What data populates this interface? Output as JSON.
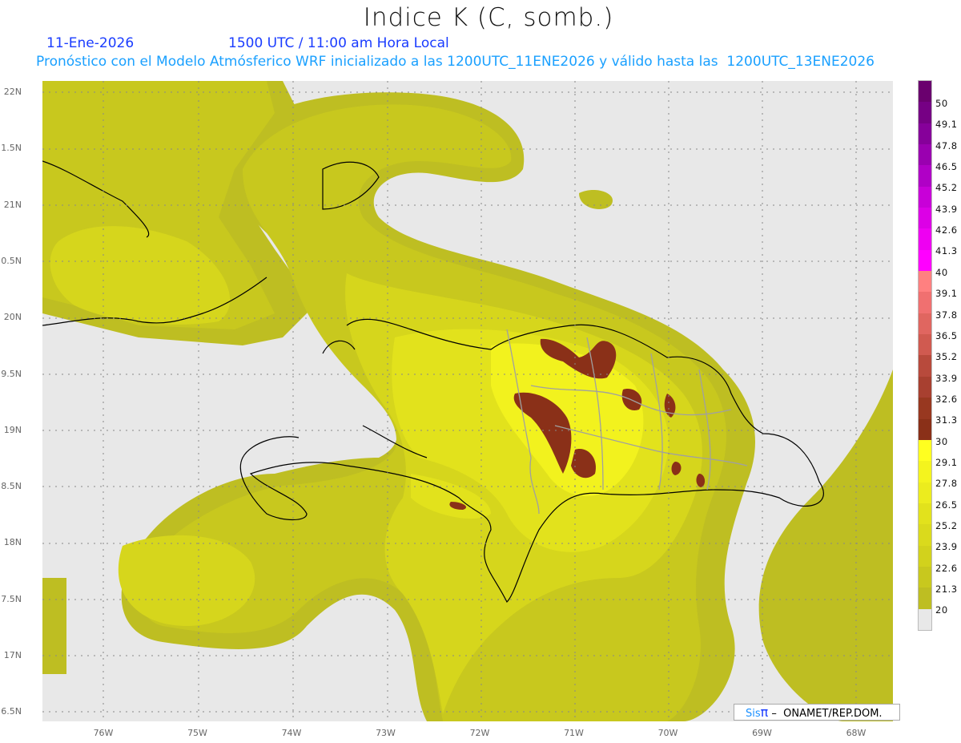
{
  "header": {
    "title": "Indice K (C, somb.)",
    "date": "11-Ene-2026",
    "time": "1500 UTC / 11:00 am Hora Local",
    "description": "Pronóstico con el Modelo Atmósferico WRF inicializado a las 1200UTC_11ENE2026 y válido hasta las  1200UTC_13ENE2026"
  },
  "map": {
    "y_labels": [
      "22N",
      "1.5N",
      "21N",
      "0.5N",
      "20N",
      "9.5N",
      "19N",
      "8.5N",
      "18N",
      "7.5N",
      "17N",
      "6.5N"
    ],
    "x_labels": [
      "76W",
      "75W",
      "74W",
      "73W",
      "72W",
      "71W",
      "70W",
      "69W",
      "68W"
    ],
    "lon_range": [
      -76.65,
      -67.6
    ],
    "lat_range": [
      16.4,
      22.1
    ]
  },
  "colorbar": {
    "labels": [
      "50",
      "49.1",
      "47.8",
      "46.5",
      "45.2",
      "43.9",
      "42.6",
      "41.3",
      "40",
      "39.1",
      "37.8",
      "36.5",
      "35.2",
      "33.9",
      "32.6",
      "31.3",
      "30",
      "29.1",
      "27.8",
      "26.5",
      "25.2",
      "23.9",
      "22.6",
      "21.3",
      "20"
    ],
    "colors": [
      "#6a006e",
      "#760084",
      "#86009a",
      "#9a00b0",
      "#b000c6",
      "#c800d8",
      "#dc00e6",
      "#ee00f2",
      "#ff00ff",
      "#ff8080",
      "#f07070",
      "#e06660",
      "#d05a50",
      "#b84a3c",
      "#a84030",
      "#983820",
      "#8a3018",
      "#ffff20",
      "#f4f41e",
      "#ecec1e",
      "#e2e21c",
      "#dada1c",
      "#d2d21c",
      "#c8c81e",
      "#bebe22",
      "#e8e8e8"
    ]
  },
  "credit": {
    "brand": "Sis",
    "pi": "π",
    "text": " –  ONAMET/REP.DOM."
  }
}
